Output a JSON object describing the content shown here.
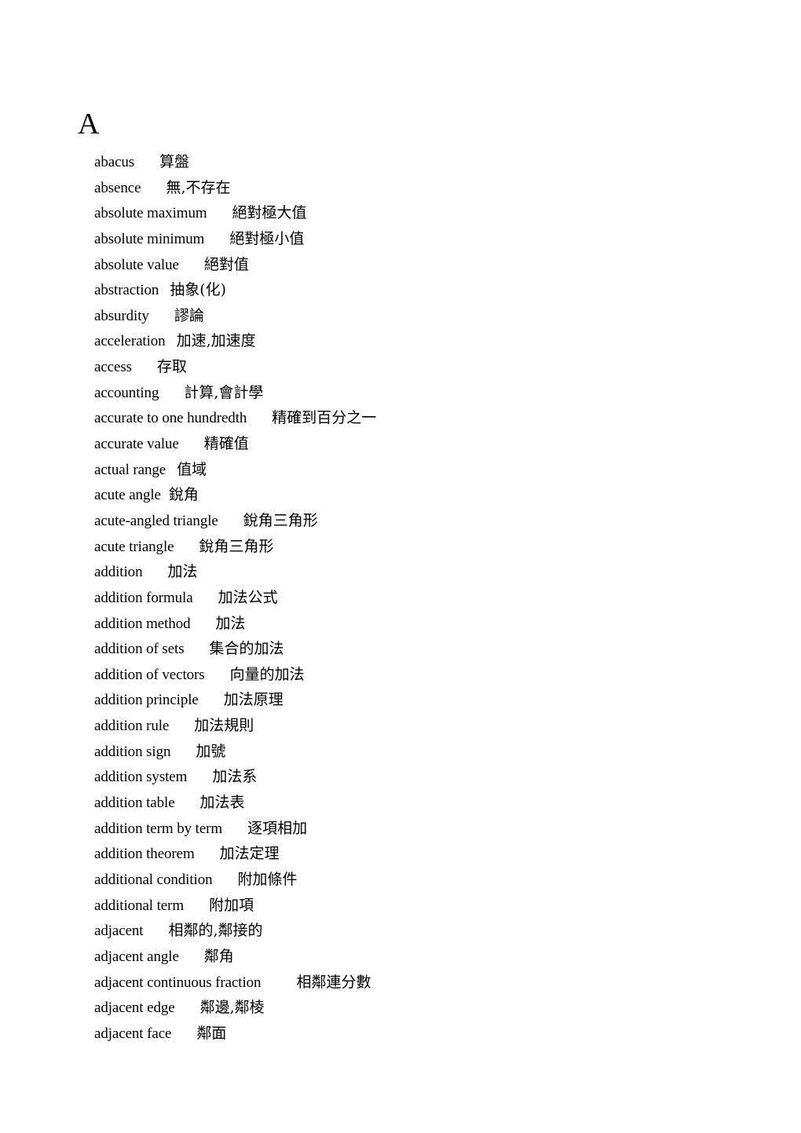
{
  "section": {
    "heading": "A"
  },
  "entries": [
    {
      "term": "abacus",
      "translation": "算盤"
    },
    {
      "term": "absence",
      "translation": "無,不存在"
    },
    {
      "term": "absolute maximum",
      "translation": "絕對極大值"
    },
    {
      "term": "absolute minimum",
      "translation": "絕對極小值"
    },
    {
      "term": "absolute value",
      "translation": "絕對值"
    },
    {
      "term": "abstraction",
      "translation": "抽象(化)"
    },
    {
      "term": "absurdity",
      "translation": "謬論"
    },
    {
      "term": "acceleration",
      "translation": "加速,加速度"
    },
    {
      "term": "access",
      "translation": "存取"
    },
    {
      "term": "accounting",
      "translation": "計算,會計學"
    },
    {
      "term": "accurate to one hundredth",
      "translation": "精確到百分之一"
    },
    {
      "term": "accurate value",
      "translation": "精確值"
    },
    {
      "term": "actual range",
      "translation": "值域"
    },
    {
      "term": "acute angle",
      "translation": "銳角"
    },
    {
      "term": "acute-angled triangle",
      "translation": "銳角三角形"
    },
    {
      "term": "acute triangle",
      "translation": "銳角三角形"
    },
    {
      "term": "addition",
      "translation": "加法"
    },
    {
      "term": "addition formula",
      "translation": "加法公式"
    },
    {
      "term": "addition method",
      "translation": "加法"
    },
    {
      "term": "addition of sets",
      "translation": "集合的加法"
    },
    {
      "term": "addition of vectors",
      "translation": "向量的加法"
    },
    {
      "term": "addition principle",
      "translation": "加法原理"
    },
    {
      "term": "addition rule",
      "translation": "加法規則"
    },
    {
      "term": "addition sign",
      "translation": "加號"
    },
    {
      "term": "addition system",
      "translation": "加法系"
    },
    {
      "term": "addition table",
      "translation": "加法表"
    },
    {
      "term": "addition term by term",
      "translation": "逐項相加"
    },
    {
      "term": "addition theorem",
      "translation": "加法定理"
    },
    {
      "term": "additional condition",
      "translation": "附加條件"
    },
    {
      "term": "additional term",
      "translation": "附加項"
    },
    {
      "term": "adjacent",
      "translation": "相鄰的,鄰接的"
    },
    {
      "term": "adjacent angle",
      "translation": "鄰角"
    },
    {
      "term": "adjacent continuous fraction",
      "translation": "相鄰連分數"
    },
    {
      "term": "adjacent edge",
      "translation": "鄰邊,鄰棱"
    },
    {
      "term": "adjacent face",
      "translation": "鄰面"
    }
  ]
}
